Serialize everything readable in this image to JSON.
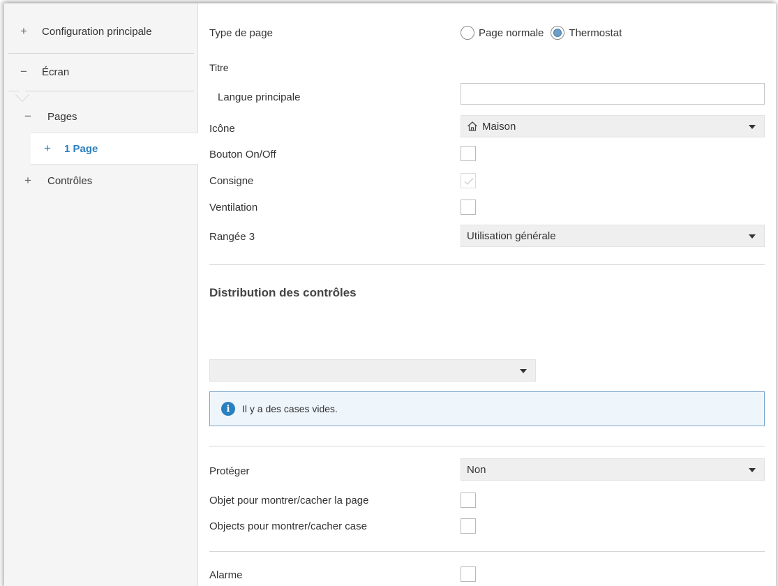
{
  "sidebar": {
    "items": [
      {
        "sign": "+",
        "label": "Configuration principale"
      },
      {
        "sign": "−",
        "label": "Écran"
      },
      {
        "sign": "−",
        "label": "Pages"
      },
      {
        "sign": "+",
        "label": "1 Page"
      },
      {
        "sign": "+",
        "label": "Contrôles"
      }
    ]
  },
  "main": {
    "page_type": {
      "label": "Type de page",
      "options": [
        "Page normale",
        "Thermostat"
      ],
      "selected": "Thermostat"
    },
    "title": {
      "label": "Titre",
      "main_language_label": "Langue principale",
      "main_language_value": ""
    },
    "icon": {
      "label": "Icône",
      "value": "Maison",
      "icon_name": "house-icon"
    },
    "on_off_button": {
      "label": "Bouton On/Off",
      "checked": false
    },
    "setpoint": {
      "label": "Consigne",
      "checked": true,
      "disabled": true
    },
    "ventilation": {
      "label": "Ventilation",
      "checked": false
    },
    "row3": {
      "label": "Rangée 3",
      "value": "Utilisation générale"
    },
    "distribution": {
      "title": "Distribution des contrôles",
      "select_value": "",
      "info_text": "Il y a des cases vides."
    },
    "protect": {
      "label": "Protéger",
      "value": "Non"
    },
    "show_hide_page": {
      "label": "Objet pour montrer/cacher la page",
      "checked": false
    },
    "show_hide_box": {
      "label": "Objects pour montrer/cacher case",
      "checked": false
    },
    "alarm": {
      "label": "Alarme",
      "checked": false
    }
  },
  "colors": {
    "accent": "#2a7fbf",
    "sidebar_bg": "#f5f5f5",
    "info_bg": "#eef5fb",
    "info_border": "#7ba6cc"
  }
}
